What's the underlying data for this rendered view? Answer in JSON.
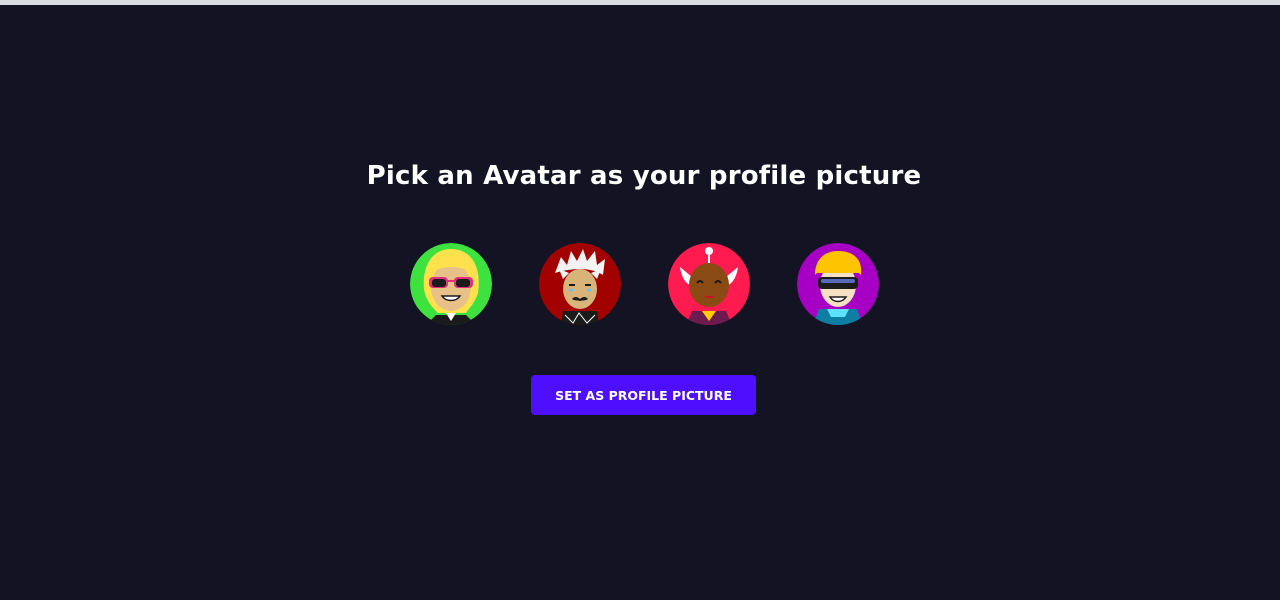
{
  "page": {
    "title": "Pick an Avatar as your profile picture"
  },
  "avatars": [
    {
      "name": "avatar-blonde-pink-sunglasses",
      "bg": "#3ee23e",
      "icon": "blonde-sunglasses-avatar"
    },
    {
      "name": "avatar-white-hair-mustache",
      "bg": "#a30000",
      "icon": "white-hair-avatar"
    },
    {
      "name": "avatar-horns",
      "bg": "#ff1a4f",
      "icon": "horned-avatar"
    },
    {
      "name": "avatar-yellow-hair-visor",
      "bg": "#a700c4",
      "icon": "visor-avatar"
    }
  ],
  "button": {
    "label": "Set as Profile Picture",
    "color": "#4e0eff"
  },
  "colors": {
    "background": "#131324",
    "text": "#ffffff"
  }
}
